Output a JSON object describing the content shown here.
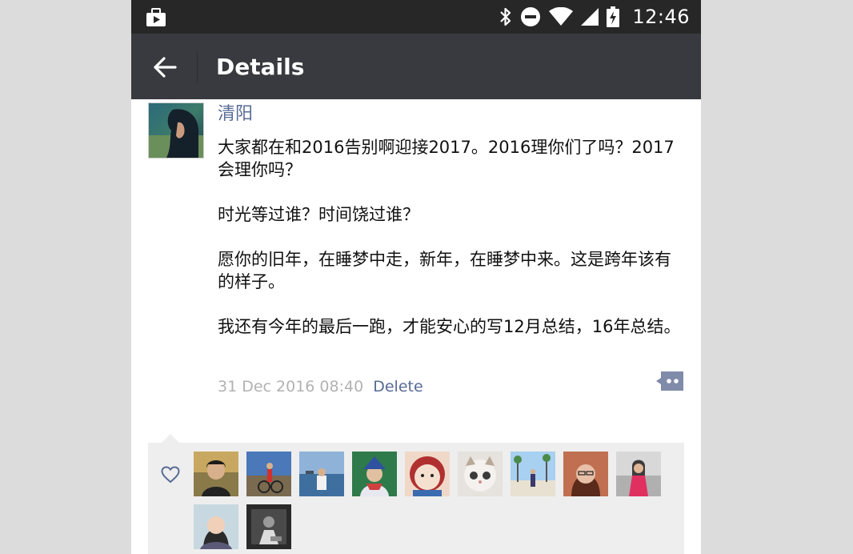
{
  "status_bar": {
    "time": "12:46",
    "icons": [
      "briefcase-icon",
      "bluetooth-icon",
      "do-not-disturb-icon",
      "wifi-icon",
      "signal-icon",
      "battery-charging-icon"
    ]
  },
  "app_bar": {
    "title": "Details",
    "back_icon": "back-arrow-icon"
  },
  "post": {
    "author": "清阳",
    "paragraphs": [
      "大家都在和2016告别啊迎接2017。2016理你们了吗？2017会理你吗？",
      "时光等过谁？时间饶过谁？",
      "愿你的旧年，在睡梦中走，新年，在睡梦中来。这是跨年该有的样子。",
      "我还有今年的最后一跑，才能安心的写12月总结，16年总结。"
    ],
    "timestamp": "31 Dec 2016 08:40",
    "delete_label": "Delete",
    "comment_icon": "comment-bubble-icon"
  },
  "likes": {
    "icon": "heart-outline-icon",
    "count": 11
  },
  "colors": {
    "status_bar": "#272727",
    "app_bar": "#393a3f",
    "link_blue": "#576b95",
    "meta_gray": "#b2b2b2",
    "likes_bg": "#eeeeee"
  }
}
